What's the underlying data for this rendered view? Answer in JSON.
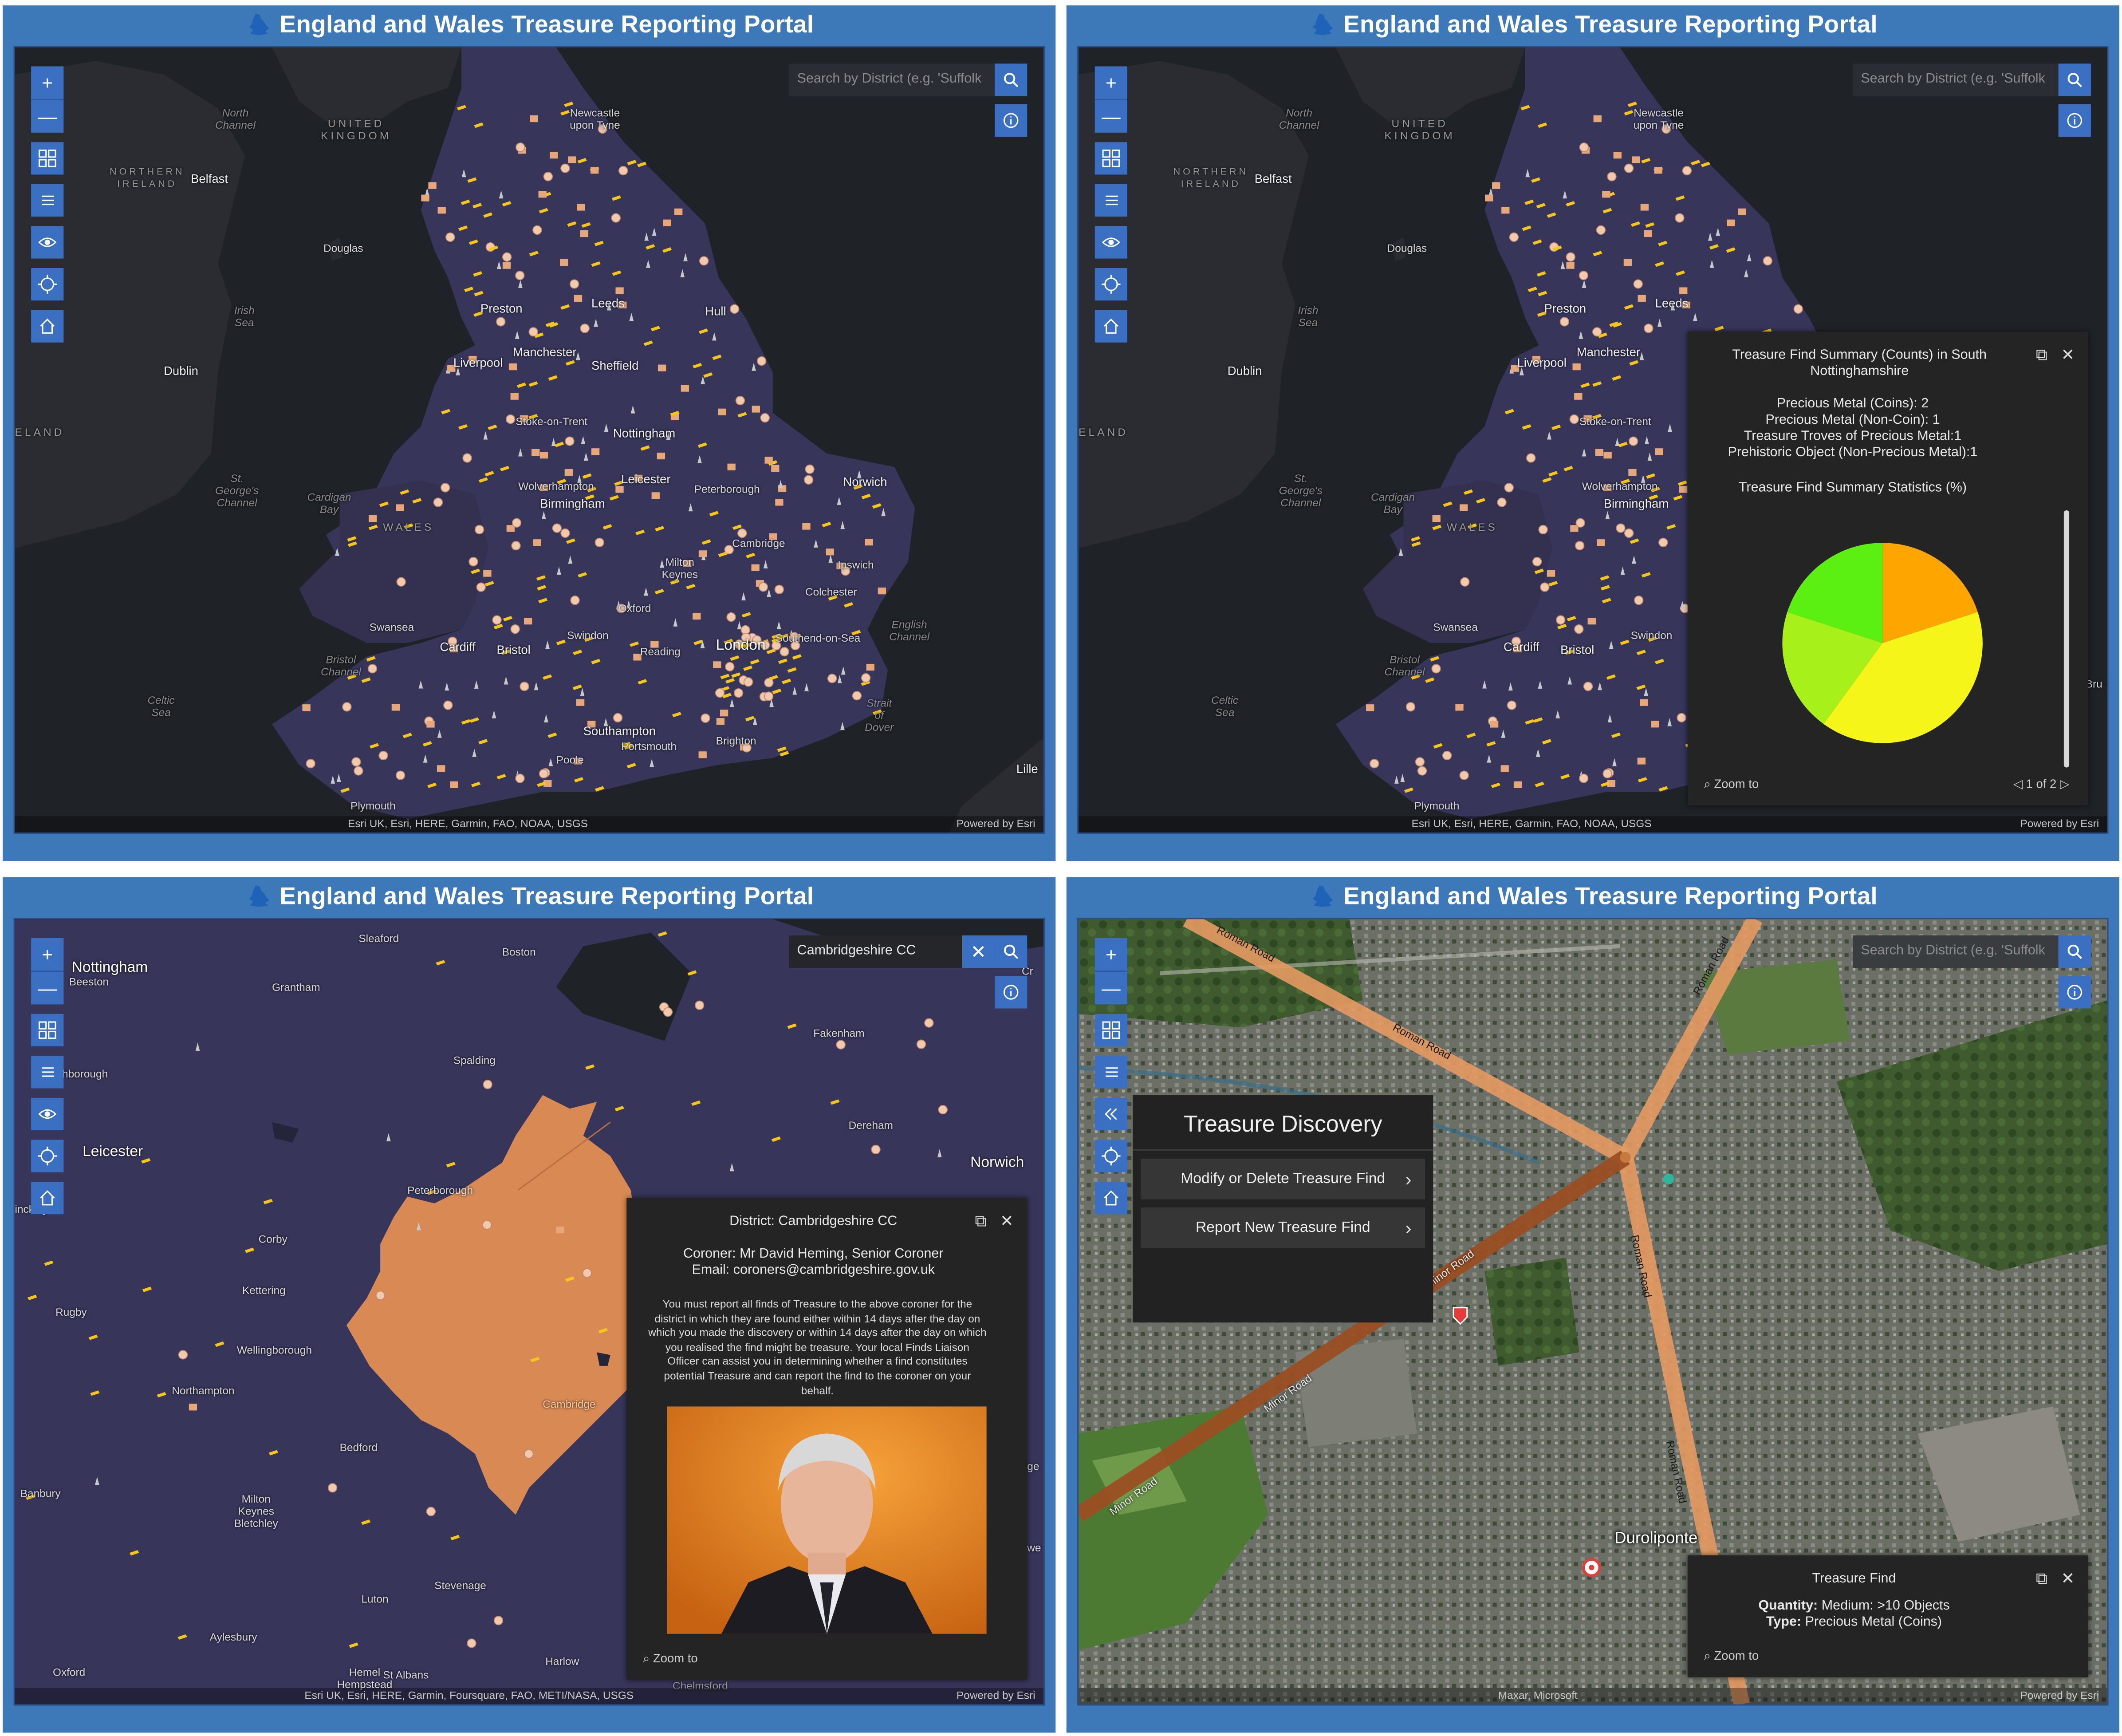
{
  "portal_title": "England and Wales Treasure Reporting Portal",
  "colors": {
    "header_bg": "#3d78b8",
    "button_bg": "#3a6fc2",
    "land": "#37355a",
    "water": "#1f2227",
    "coin_marker": "#f5c518",
    "circle_marker": "#f3c9ae",
    "district_fill": "#d98a54"
  },
  "tools": {
    "zoom_in": "+",
    "zoom_out": "—",
    "icons": [
      "zoom-in-icon",
      "zoom-out-icon",
      "qr-grid-icon",
      "list-icon",
      "eye-icon",
      "locate-icon",
      "home-icon",
      "collapse-icon"
    ]
  },
  "search": {
    "placeholder": "Search by District (e.g. 'Suffolk",
    "active_value": "Cambridgeshire CC"
  },
  "attribution": {
    "overview": "Esri UK, Esri, HERE, Garmin, FAO, NOAA, USGS",
    "regional": "Esri UK, Esri, HERE, Garmin, Foursquare, FAO, METI/NASA, USGS",
    "satellite": "Maxar, Microsoft",
    "powered": "Powered by Esri"
  },
  "overview_labels": {
    "north_channel": "North\nChannel",
    "united_kingdom": "UNITED\nKINGDOM",
    "northern_ireland": "NORTHERN\nIRELAND",
    "belfast": "Belfast",
    "douglas": "Douglas",
    "irish_sea": "Irish\nSea",
    "dublin": "Dublin",
    "ireland": "ELAND",
    "st_georges": "St.\nGeorge's\nChannel",
    "cardigan_bay": "Cardigan\nBay",
    "wales": "WALES",
    "celtic_sea": "Celtic\nSea",
    "bristol_channel": "Bristol\nChannel",
    "newcastle": "Newcastle\nupon Tyne",
    "preston": "Preston",
    "leeds": "Leeds",
    "hull": "Hull",
    "liverpool": "Liverpool",
    "manchester": "Manchester",
    "sheffield": "Sheffield",
    "stoke": "Stoke-on-Trent",
    "nottingham": "Nottingham",
    "wolverhampton": "Wolverhampton",
    "leicester": "Leicester",
    "peterborough": "Peterborough",
    "norwich": "Norwich",
    "birmingham": "Birmingham",
    "cambridge": "Cambridge",
    "ipswich": "Ipswich",
    "milton_keynes": "Milton\nKeynes",
    "colchester": "Colchester",
    "oxford": "Oxford",
    "swansea": "Swansea",
    "swindon": "Swindon",
    "cardiff": "Cardiff",
    "bristol": "Bristol",
    "reading": "Reading",
    "london": "London",
    "southend": "Southend-on-Sea",
    "english_channel": "English\nChannel",
    "strait_dover": "Strait\nof\nDover",
    "southampton": "Southampton",
    "portsmouth": "Portsmouth",
    "brighton": "Brighton",
    "poole": "Poole",
    "plymouth": "Plymouth",
    "lille": "Lille",
    "bru": "Bru"
  },
  "summary_popup": {
    "title": "Treasure Find Summary (Counts) in South Nottinghamshire",
    "lines": [
      "Precious Metal (Coins): 2",
      "Precious Metal (Non-Coin): 1",
      "Treasure Troves of Precious Metal:1",
      "Prehistoric Object (Non-Precious Metal):1"
    ],
    "stats_title": "Treasure Find Summary Statistics (%)",
    "zoom_to": "Zoom to",
    "pager": "1 of 2"
  },
  "chart_data": {
    "type": "pie",
    "title": "",
    "categories": [
      "Precious Metal (Coins)",
      "Precious Metal (Non-Coin)",
      "Treasure Troves of Precious Metal",
      "Prehistoric Object (Non-Precious Metal)"
    ],
    "values": [
      2,
      1,
      1,
      1
    ],
    "colors": [
      "#f5f51a",
      "#a8f01a",
      "#5bef12",
      "#ffa500"
    ]
  },
  "regional_labels": {
    "nottingham": "Nottingham",
    "beeston": "Beeston",
    "sleaford": "Sleaford",
    "boston": "Boston",
    "grantham": "Grantham",
    "loughborough": "ughborough",
    "spalding": "Spalding",
    "fakenham": "Fakenham",
    "leicester": "Leicester",
    "hinckley": "inckley",
    "dereham": "Dereham",
    "norwich": "Norwich",
    "peterborough": "Peterborough",
    "corby": "Corby",
    "kettering": "Kettering",
    "rugby": "Rugby",
    "wellingborough": "Wellingborough",
    "northampton": "Northampton",
    "cambridge": "Cambridge",
    "bedford": "Bedford",
    "banbury": "Banbury",
    "milton_keynes": "Milton\nKeynes\nBletchley",
    "stevenage": "Stevenage",
    "luton": "Luton",
    "aylesbury": "Aylesbury",
    "hemel": "Hemel\nHempstead",
    "st_albans": "St Albans",
    "harlow": "Harlow",
    "chelmsford": "Chelmsford",
    "oxford": "Oxford",
    "cr": "Cr",
    "ge": "ge",
    "we": "we"
  },
  "district_popup": {
    "title": "District: Cambridgeshire CC",
    "coroner": "Coroner: Mr David Heming, Senior Coroner",
    "email": "Email: coroners@cambridgeshire.gov.uk",
    "body": "You must report all finds of Treasure to the above coroner for the district in which they are found either within 14 days after the day on which you made the discovery or within 14 days after the day on which you realised the find might be treasure. Your local Finds Liaison Officer can assist you in determining whether a find constitutes potential Treasure and can report the find to the coroner on your behalf.",
    "zoom_to": "Zoom to"
  },
  "satellite_labels": {
    "roman_road_1": "Roman Road",
    "roman_road_2": "Roman Road",
    "roman_road_3": "Roman Road",
    "roman_road_4": "Roman Road",
    "roman_road_5": "Roman Road",
    "minor_road_1": "Minor Road",
    "minor_road_2": "Minor Road",
    "minor_road_3": "Minor Road",
    "site": "Duroliponte"
  },
  "treasure_discovery": {
    "title": "Treasure Discovery",
    "items": [
      "Modify or Delete Treasure Find",
      "Report New Treasure Find"
    ]
  },
  "find_popup": {
    "title": "Treasure Find",
    "quantity_label": "Quantity:",
    "quantity_value": "Medium: >10 Objects",
    "type_label": "Type:",
    "type_value": "Precious Metal (Coins)",
    "zoom_to": "Zoom to"
  }
}
